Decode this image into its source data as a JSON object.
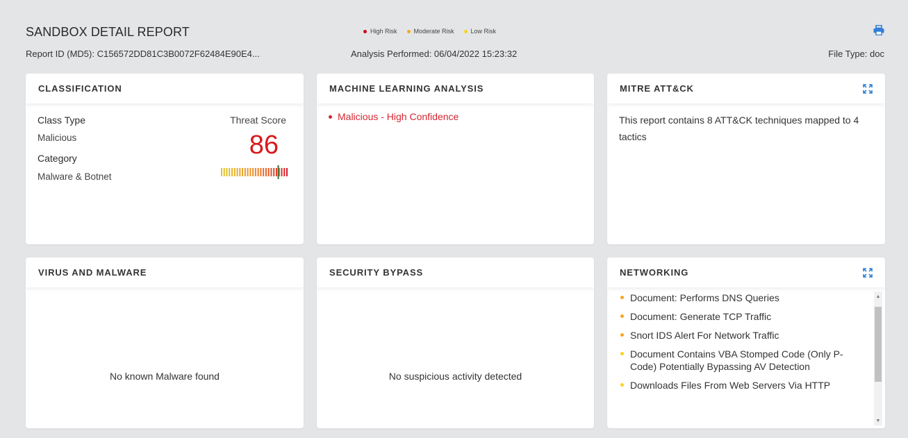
{
  "header": {
    "title": "SANDBOX DETAIL REPORT",
    "report_id": "Report ID (MD5): C156572DD81C3B0072F62484E90E4...",
    "analysis": "Analysis Performed: 06/04/2022 15:23:32",
    "file_type": "File Type: doc",
    "print_icon": "printer-icon",
    "legend": [
      {
        "label": "High Risk",
        "color": "#d0021b"
      },
      {
        "label": "Moderate Risk",
        "color": "#f5a623"
      },
      {
        "label": "Low Risk",
        "color": "#f8d31c"
      }
    ]
  },
  "classification": {
    "title": "CLASSIFICATION",
    "class_type_label": "Class Type",
    "class_type_value": "Malicious",
    "category_label": "Category",
    "category_value": "Malware & Botnet",
    "threat_score_label": "Threat Score",
    "threat_score": "86",
    "score_fraction": 0.86
  },
  "ml": {
    "title": "MACHINE LEARNING ANALYSIS",
    "result": "Malicious - High Confidence"
  },
  "mitre": {
    "title": "MITRE ATT&CK",
    "text": "This report contains 8 ATT&CK techniques mapped to 4 tactics",
    "expand_icon": "expand-icon"
  },
  "virus": {
    "title": "VIRUS AND MALWARE",
    "message": "No known Malware found"
  },
  "bypass": {
    "title": "SECURITY BYPASS",
    "message": "No suspicious activity detected"
  },
  "networking": {
    "title": "NETWORKING",
    "expand_icon": "expand-icon",
    "items": [
      {
        "text": "Document: Performs DNS Queries",
        "color": "#f5a623"
      },
      {
        "text": "Document: Generate TCP Traffic",
        "color": "#f5a623"
      },
      {
        "text": "Snort IDS Alert For Network Traffic",
        "color": "#f5a623"
      },
      {
        "text": "Document Contains VBA Stomped Code (Only P-Code) Potentially Bypassing AV Detection",
        "color": "#f8d31c"
      },
      {
        "text": "Downloads Files From Web Servers Via HTTP",
        "color": "#f8d31c"
      }
    ]
  }
}
